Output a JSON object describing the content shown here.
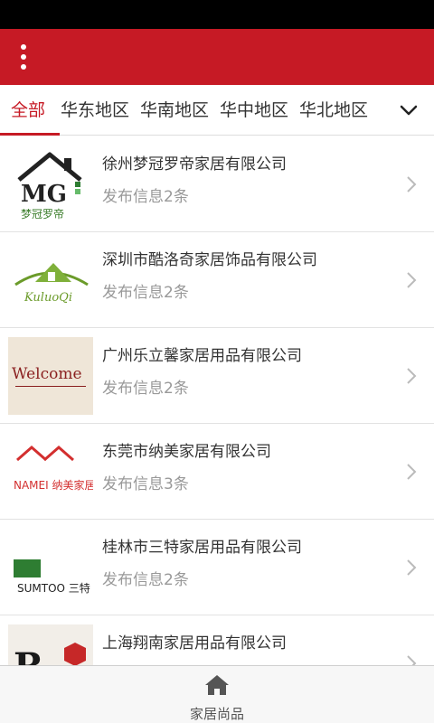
{
  "header": {
    "menu_icon": "more-vertical-icon"
  },
  "regions": {
    "tabs": [
      {
        "label": "全部"
      },
      {
        "label": "华东地区"
      },
      {
        "label": "华南地区"
      },
      {
        "label": "华中地区"
      },
      {
        "label": "华北地区"
      }
    ],
    "active_index": 0,
    "expand_icon": "chevron-down-icon"
  },
  "companies": [
    {
      "name": "徐州梦冠罗帝家居有限公司",
      "info": "发布信息2条",
      "logo_text": "梦冠罗帝"
    },
    {
      "name": "深圳市酷洛奇家居饰品有限公司",
      "info": "发布信息2条",
      "logo_text": "KuluoQi"
    },
    {
      "name": "广州乐立馨家居用品有限公司",
      "info": "发布信息2条",
      "logo_text": "Welcome"
    },
    {
      "name": "东莞市纳美家居有限公司",
      "info": "发布信息3条",
      "logo_text": "NAMEI 纳美家居"
    },
    {
      "name": "桂林市三特家居用品有限公司",
      "info": "发布信息2条",
      "logo_text": "SUMTOO 三特"
    },
    {
      "name": "上海翔南家居用品有限公司",
      "info": "",
      "logo_text": "R"
    }
  ],
  "bottom_nav": {
    "label": "家居尚品",
    "icon": "home-icon"
  },
  "colors": {
    "brand": "#c61a25",
    "text": "#333333",
    "muted": "#999999"
  }
}
